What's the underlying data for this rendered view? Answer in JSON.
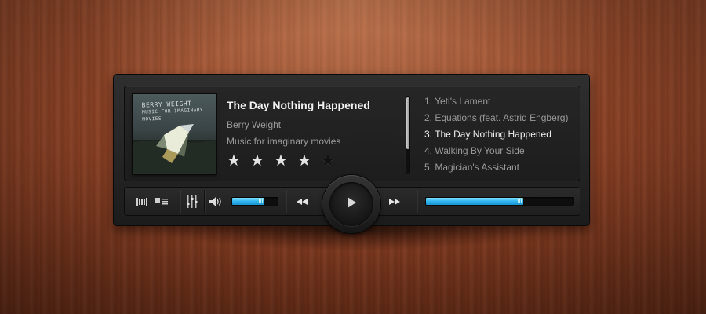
{
  "now_playing": {
    "title": "The Day Nothing Happened",
    "artist": "Berry Weight",
    "album": "Music for imaginary movies",
    "rating": 4,
    "rating_max": 5,
    "cover_text_line1": "BERRY WEIGHT",
    "cover_text_line2": "MUSIC FOR IMAGINARY MOVIES"
  },
  "playlist": {
    "items": [
      {
        "label": "1. Yeti's Lament",
        "current": false
      },
      {
        "label": "2. Equations (feat. Astrid Engberg)",
        "current": false
      },
      {
        "label": "3. The Day Nothing Happened",
        "current": true
      },
      {
        "label": "4. Walking By Your Side",
        "current": false
      },
      {
        "label": "5. Magician's Assistant",
        "current": false
      }
    ]
  },
  "controls": {
    "volume_level": 0.7,
    "progress": 0.66,
    "icons": [
      "library-icon",
      "playlist-view-icon",
      "equalizer-icon",
      "volume-icon",
      "rewind-icon",
      "play-icon",
      "fast-forward-icon"
    ]
  },
  "colors": {
    "accent": "#2fb4ee",
    "text_primary": "#f2f2f2",
    "text_secondary": "#9a9a9a"
  }
}
